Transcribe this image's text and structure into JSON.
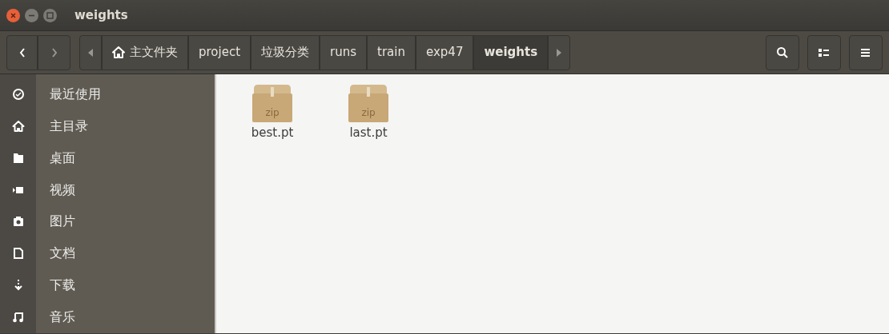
{
  "window": {
    "title": "weights"
  },
  "path": [
    {
      "label": "主文件夹",
      "kind": "home",
      "selected": false
    },
    {
      "label": "project",
      "kind": "folder",
      "selected": false
    },
    {
      "label": "垃圾分类",
      "kind": "folder",
      "selected": false
    },
    {
      "label": "runs",
      "kind": "folder",
      "selected": false
    },
    {
      "label": "train",
      "kind": "folder",
      "selected": false
    },
    {
      "label": "exp47",
      "kind": "folder",
      "selected": false
    },
    {
      "label": "weights",
      "kind": "folder",
      "selected": true
    }
  ],
  "sidebar": {
    "items": [
      {
        "label": "最近使用",
        "kind": "recent"
      },
      {
        "label": "主目录",
        "kind": "home"
      },
      {
        "label": "桌面",
        "kind": "desktop"
      },
      {
        "label": "视频",
        "kind": "video"
      },
      {
        "label": "图片",
        "kind": "pictures"
      },
      {
        "label": "文档",
        "kind": "documents"
      },
      {
        "label": "下载",
        "kind": "downloads"
      },
      {
        "label": "音乐",
        "kind": "music"
      }
    ]
  },
  "files": [
    {
      "name": "best.pt",
      "icon_label": "zip"
    },
    {
      "name": "last.pt",
      "icon_label": "zip"
    }
  ]
}
